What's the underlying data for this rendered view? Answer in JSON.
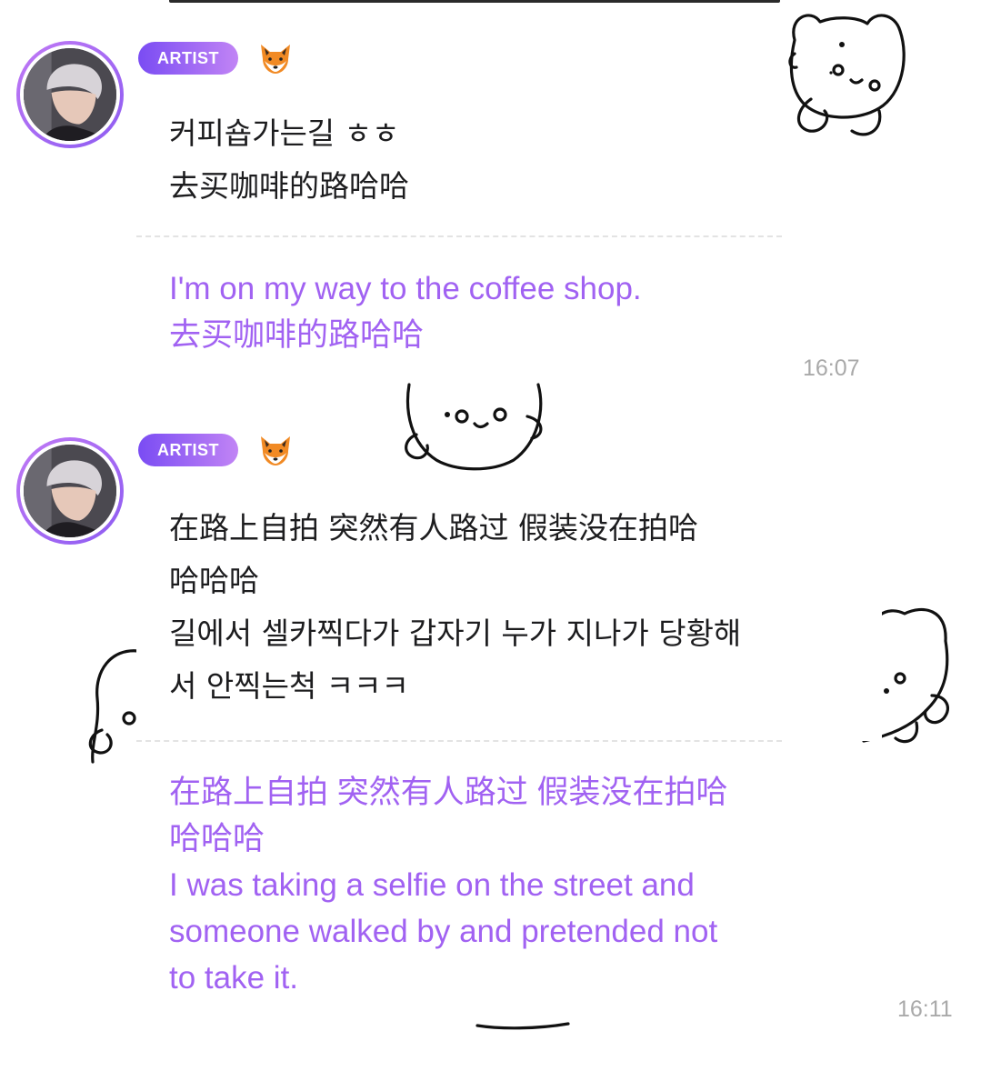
{
  "messages": [
    {
      "badge": "ARTIST",
      "emoji": "🦊",
      "lines": [
        "커피숍가는길 ㅎㅎ",
        "去买咖啡的路哈哈"
      ],
      "translation": [
        "I'm on my way to the coffee shop.",
        "去买咖啡的路哈哈"
      ],
      "time": "16:07"
    },
    {
      "badge": "ARTIST",
      "emoji": "🦊",
      "lines": [
        "在路上自拍 突然有人路过 假装没在拍哈",
        "哈哈哈",
        "길에서 셀카찍다가 갑자기 누가 지나가 당황해",
        "서  안찍는척 ㅋㅋㅋ"
      ],
      "translation": [
        "在路上自拍 突然有人路过 假装没在拍哈",
        "哈哈哈",
        "I was taking a selfie on the street and",
        "someone walked by and pretended not",
        "to take it."
      ],
      "time": "16:11"
    }
  ],
  "colors": {
    "accent": "#a162f2",
    "badge_start": "#7a4cf3",
    "badge_end": "#c184f5",
    "timestamp": "#a9a9a9"
  },
  "icons": [
    "fox-emoji-icon",
    "bear-sticker-doodle"
  ]
}
